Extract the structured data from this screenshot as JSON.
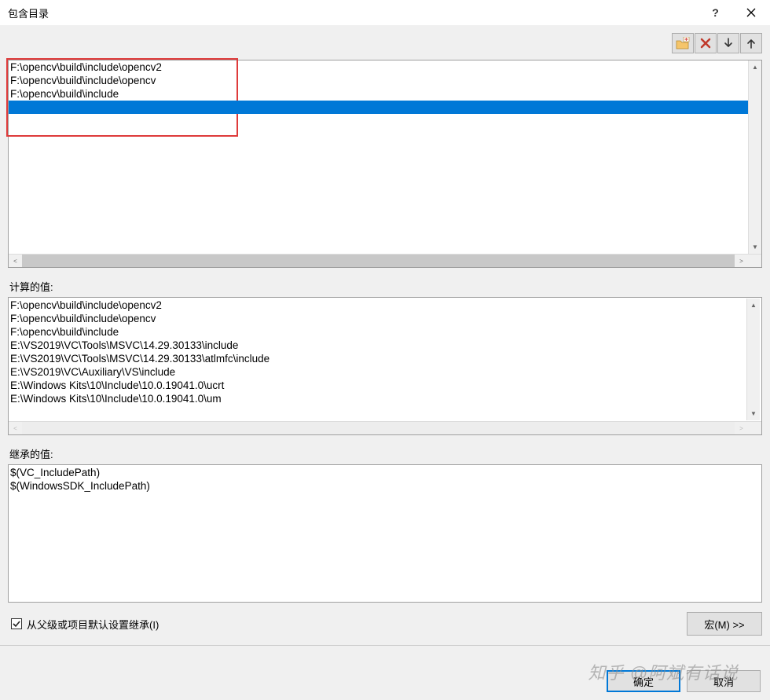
{
  "window": {
    "title": "包含目录"
  },
  "editor": {
    "rows": [
      "F:\\opencv\\build\\include\\opencv2",
      "F:\\opencv\\build\\include\\opencv",
      "F:\\opencv\\build\\include"
    ]
  },
  "computed": {
    "label": "计算的值:",
    "rows": [
      "F:\\opencv\\build\\include\\opencv2",
      "F:\\opencv\\build\\include\\opencv",
      "F:\\opencv\\build\\include",
      "E:\\VS2019\\VC\\Tools\\MSVC\\14.29.30133\\include",
      "E:\\VS2019\\VC\\Tools\\MSVC\\14.29.30133\\atlmfc\\include",
      "E:\\VS2019\\VC\\Auxiliary\\VS\\include",
      "E:\\Windows Kits\\10\\Include\\10.0.19041.0\\ucrt",
      "E:\\Windows Kits\\10\\Include\\10.0.19041.0\\um"
    ]
  },
  "inherited": {
    "label": "继承的值:",
    "rows": [
      "$(VC_IncludePath)",
      "$(WindowsSDK_IncludePath)"
    ]
  },
  "inheritCheckbox": {
    "label": "从父级或项目默认设置继承(I)",
    "checked": true
  },
  "buttons": {
    "macro": "宏(M) >>",
    "ok": "确定",
    "cancel": "取消"
  },
  "watermark": "知乎 @阿斌有话说"
}
